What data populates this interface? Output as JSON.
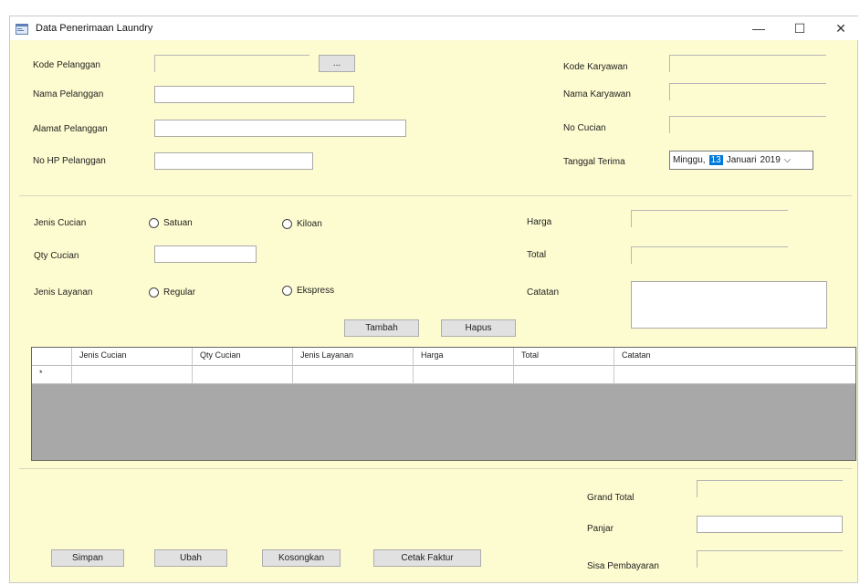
{
  "window": {
    "title": "Data Penerimaan Laundry",
    "minimize": "—",
    "maximize": "☐",
    "close": "✕"
  },
  "customer": {
    "kode_label": "Kode Pelanggan",
    "kode_value": "",
    "browse_button": "...",
    "nama_label": "Nama Pelanggan",
    "nama_value": "",
    "alamat_label": "Alamat Pelanggan",
    "alamat_value": "",
    "hp_label": "No HP Pelanggan",
    "hp_value": ""
  },
  "employee": {
    "kode_label": "Kode Karyawan",
    "kode_value": "",
    "nama_label": "Nama Karyawan",
    "nama_value": "",
    "nocucian_label": "No Cucian",
    "nocucian_value": "",
    "tanggal_label": "Tanggal Terima",
    "tanggal": {
      "day_name": "Minggu,",
      "day": "13",
      "month": "Januari",
      "year": "2019",
      "dropdown": "⌵"
    }
  },
  "laundry": {
    "jenis_label": "Jenis Cucian",
    "jenis_opt1": "Satuan",
    "jenis_opt2": "Kiloan",
    "qty_label": "Qty Cucian",
    "qty_value": "",
    "layanan_label": "Jenis Layanan",
    "layanan_opt1": "Regular",
    "layanan_opt2": "Ekspress",
    "harga_label": "Harga",
    "harga_value": "",
    "total_label": "Total",
    "total_value": "",
    "catatan_label": "Catatan",
    "catatan_value": "",
    "tambah_button": "Tambah",
    "hapus_button": "Hapus"
  },
  "grid": {
    "columns": [
      "Jenis Cucian",
      "Qty Cucian",
      "Jenis Layanan",
      "Harga",
      "Total",
      "Catatan"
    ],
    "new_row_marker": "*"
  },
  "payment": {
    "grand_total_label": "Grand Total",
    "grand_total_value": "",
    "panjar_label": "Panjar",
    "panjar_value": "",
    "sisa_label": "Sisa Pembayaran",
    "sisa_value": ""
  },
  "actions": {
    "simpan": "Simpan",
    "ubah": "Ubah",
    "kosongkan": "Kosongkan",
    "cetak": "Cetak Faktur"
  }
}
